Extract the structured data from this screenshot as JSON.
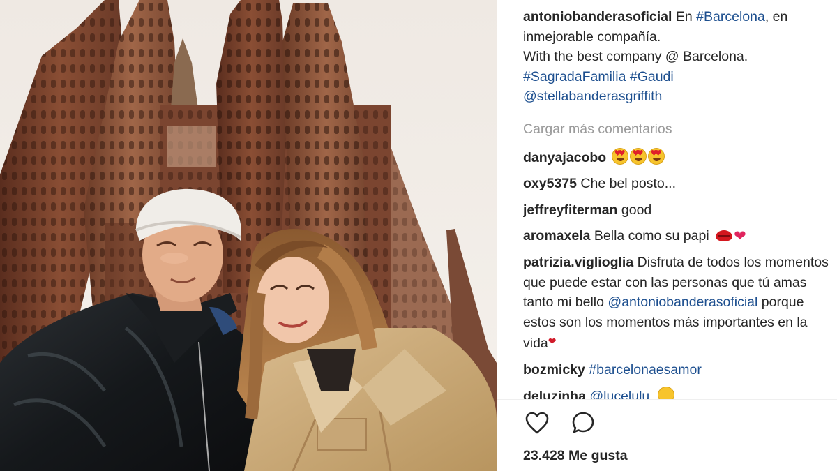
{
  "caption": {
    "username": "antoniobanderasoficial",
    "text_1": "En",
    "tag_barcelona": "#Barcelona",
    "text_2": ", en inmejorable compañía.",
    "text_3": "With the best company @ Barcelona.",
    "tag_sagrada": "#SagradaFamilia",
    "tag_gaudi": "#Gaudi",
    "mention": "@stellabanderasgriffith"
  },
  "load_more_label": "Cargar más comentarios",
  "comments": [
    {
      "username": "danyajacobo",
      "text": "",
      "emoji": "heart-eyes-x3"
    },
    {
      "username": "oxy5375",
      "text": "Che bel posto..."
    },
    {
      "username": "jeffreyfiterman",
      "text": "good"
    },
    {
      "username": "aromaxela",
      "text": "Bella como su papi",
      "emoji": "lips-heart"
    },
    {
      "username": "patrizia.viglioglia",
      "text_1": "Disfruta de todos los momentos que puede estar con las personas que tú amas tanto mi bello",
      "mention": "@antoniobanderasoficial",
      "text_2": "porque estos son los momentos más importantes en la vida"
    },
    {
      "username": "bozmicky",
      "tag": "#barcelonaesamor"
    },
    {
      "username": "deluzinha",
      "mention": "@lucelulu",
      "emoji": "smile"
    }
  ],
  "likes_label": "23.428 Me gusta",
  "icons": {
    "like": "heart-outline-icon",
    "comment": "comment-bubble-icon"
  },
  "colors": {
    "link": "#1d4f8f",
    "text": "#262626",
    "muted": "#9a9a9a"
  }
}
